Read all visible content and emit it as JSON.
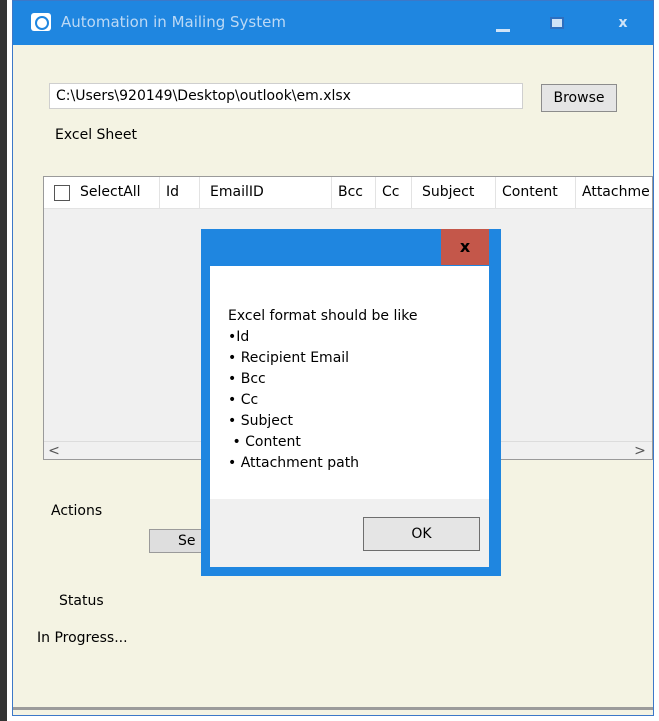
{
  "window": {
    "title": "Automation in Mailing System",
    "minimize": "",
    "close": "x"
  },
  "path_input": {
    "value": "C:\\Users\\920149\\Desktop\\outlook\\em.xlsx"
  },
  "browse_label": "Browse",
  "excel_sheet_label": "Excel Sheet",
  "grid": {
    "columns": [
      "SelectAll",
      "Id",
      "EmailID",
      "Bcc",
      "Cc",
      "Subject",
      "Content",
      "Attachme"
    ],
    "scroll_left": "<",
    "scroll_right": ">"
  },
  "actions_label": "Actions",
  "send_label": "Se",
  "status_label": "Status",
  "status_value": "In Progress...",
  "dialog": {
    "close": "x",
    "lines": [
      "Excel format should be like",
      "•Id",
      "• Recipient Email",
      "• Bcc",
      "• Cc",
      "• Subject",
      " • Content",
      "• Attachment path"
    ],
    "ok_label": "OK"
  }
}
